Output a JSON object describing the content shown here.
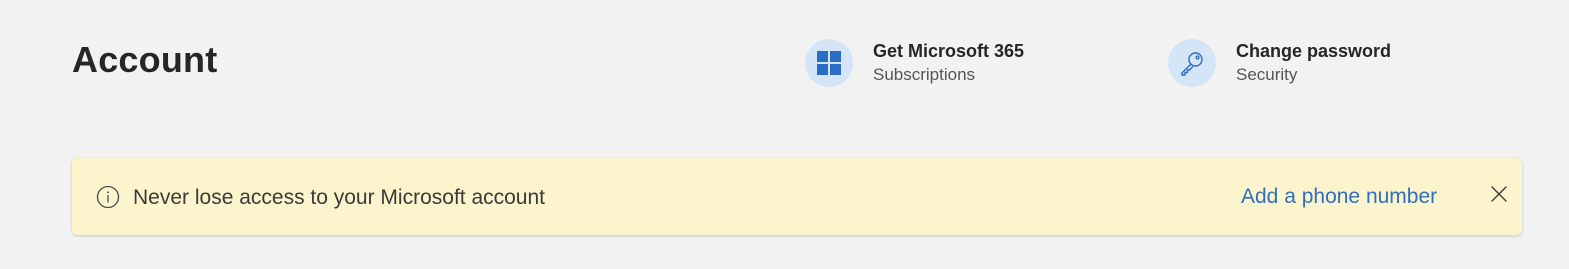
{
  "page": {
    "title": "Account"
  },
  "quick_links": [
    {
      "title": "Get Microsoft 365",
      "subtitle": "Subscriptions",
      "icon": "windows-grid-icon"
    },
    {
      "title": "Change password",
      "subtitle": "Security",
      "icon": "key-icon"
    }
  ],
  "banner": {
    "icon": "info-icon",
    "message": "Never lose access to your Microsoft account",
    "action_label": "Add a phone number",
    "close_icon": "close-icon"
  },
  "colors": {
    "background": "#f2f2f2",
    "icon_circle": "#d4e5f7",
    "icon_blue": "#2b6cc4",
    "banner_bg": "#fcf4cc",
    "link": "#2f6fbf"
  }
}
